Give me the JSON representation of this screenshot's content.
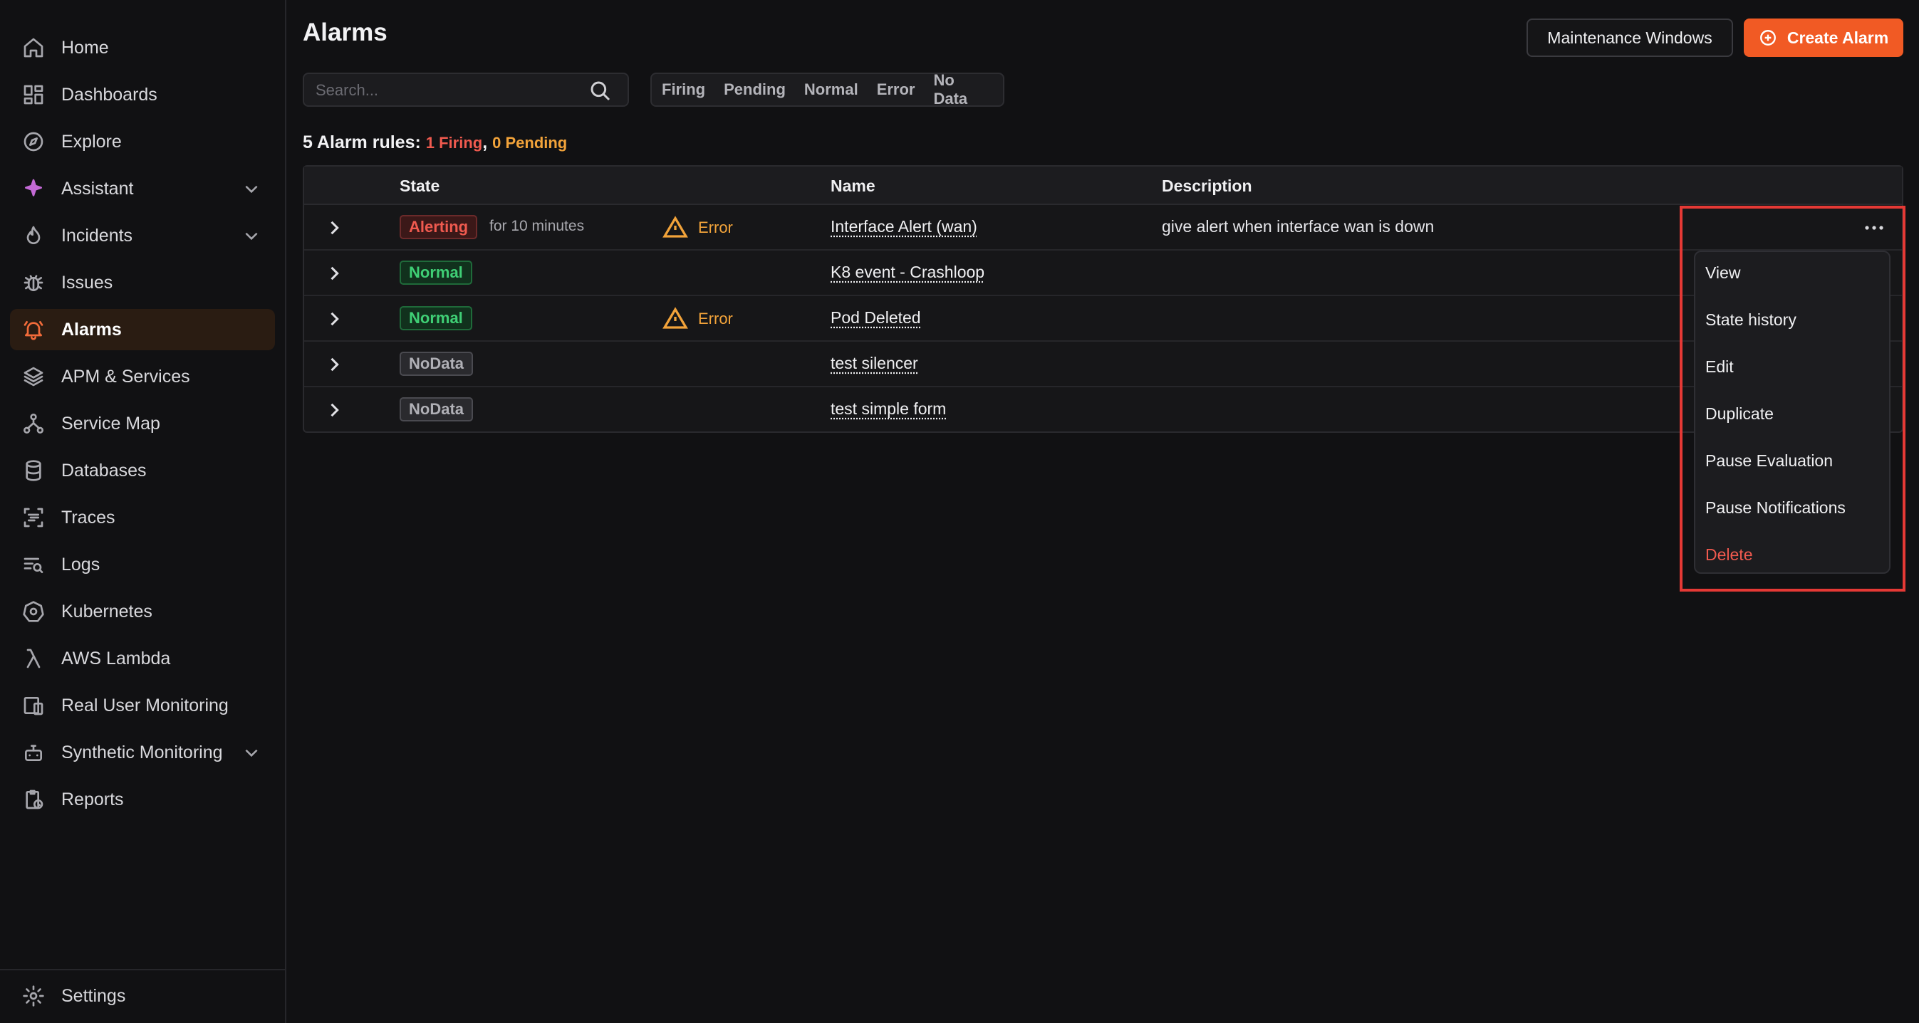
{
  "sidebar": {
    "items": [
      {
        "label": "Home",
        "icon": "home-icon"
      },
      {
        "label": "Dashboards",
        "icon": "dashboards-icon"
      },
      {
        "label": "Explore",
        "icon": "compass-icon"
      },
      {
        "label": "Assistant",
        "icon": "sparkle-icon",
        "expandable": true
      },
      {
        "label": "Incidents",
        "icon": "flame-icon",
        "expandable": true
      },
      {
        "label": "Issues",
        "icon": "bug-icon"
      },
      {
        "label": "Alarms",
        "icon": "bell-icon",
        "active": true
      },
      {
        "label": "APM & Services",
        "icon": "layers-icon"
      },
      {
        "label": "Service Map",
        "icon": "network-icon"
      },
      {
        "label": "Databases",
        "icon": "database-icon"
      },
      {
        "label": "Traces",
        "icon": "traces-icon"
      },
      {
        "label": "Logs",
        "icon": "logs-icon"
      },
      {
        "label": "Kubernetes",
        "icon": "kubernetes-icon"
      },
      {
        "label": "AWS Lambda",
        "icon": "lambda-icon"
      },
      {
        "label": "Real User Monitoring",
        "icon": "devices-icon"
      },
      {
        "label": "Synthetic Monitoring",
        "icon": "robot-icon",
        "expandable": true
      },
      {
        "label": "Reports",
        "icon": "clipboard-icon"
      }
    ],
    "settings_label": "Settings"
  },
  "header": {
    "title": "Alarms",
    "maintenance_label": "Maintenance Windows",
    "create_label": "Create Alarm"
  },
  "search": {
    "placeholder": "Search..."
  },
  "filters": [
    "Firing",
    "Pending",
    "Normal",
    "Error",
    "No Data"
  ],
  "summary": {
    "prefix": "5 Alarm rules:",
    "firing": "1 Firing",
    "separator": ",",
    "pending": "0 Pending"
  },
  "table": {
    "columns": {
      "state": "State",
      "name": "Name",
      "description": "Description"
    },
    "rows": [
      {
        "state": "Alerting",
        "state_kind": "alerting",
        "duration": "for 10 minutes",
        "health": "Error",
        "name": "Interface Alert (wan)",
        "description": "give alert when interface wan is down"
      },
      {
        "state": "Normal",
        "state_kind": "normal",
        "duration": "",
        "health": "",
        "name": "K8 event - Crashloop",
        "description": ""
      },
      {
        "state": "Normal",
        "state_kind": "normal",
        "duration": "",
        "health": "Error",
        "name": "Pod Deleted",
        "description": ""
      },
      {
        "state": "NoData",
        "state_kind": "nodata",
        "duration": "",
        "health": "",
        "name": "test silencer",
        "description": ""
      },
      {
        "state": "NoData",
        "state_kind": "nodata",
        "duration": "",
        "health": "",
        "name": "test simple form",
        "description": ""
      }
    ]
  },
  "row_menu": {
    "items": [
      "View",
      "State history",
      "Edit",
      "Duplicate",
      "Pause Evaluation",
      "Pause Notifications",
      "Delete"
    ]
  },
  "colors": {
    "accent": "#f15a24",
    "firing": "#f05a4f",
    "pending": "#f2a33a",
    "normal": "#3fcf75",
    "highlight": "#e53935"
  }
}
